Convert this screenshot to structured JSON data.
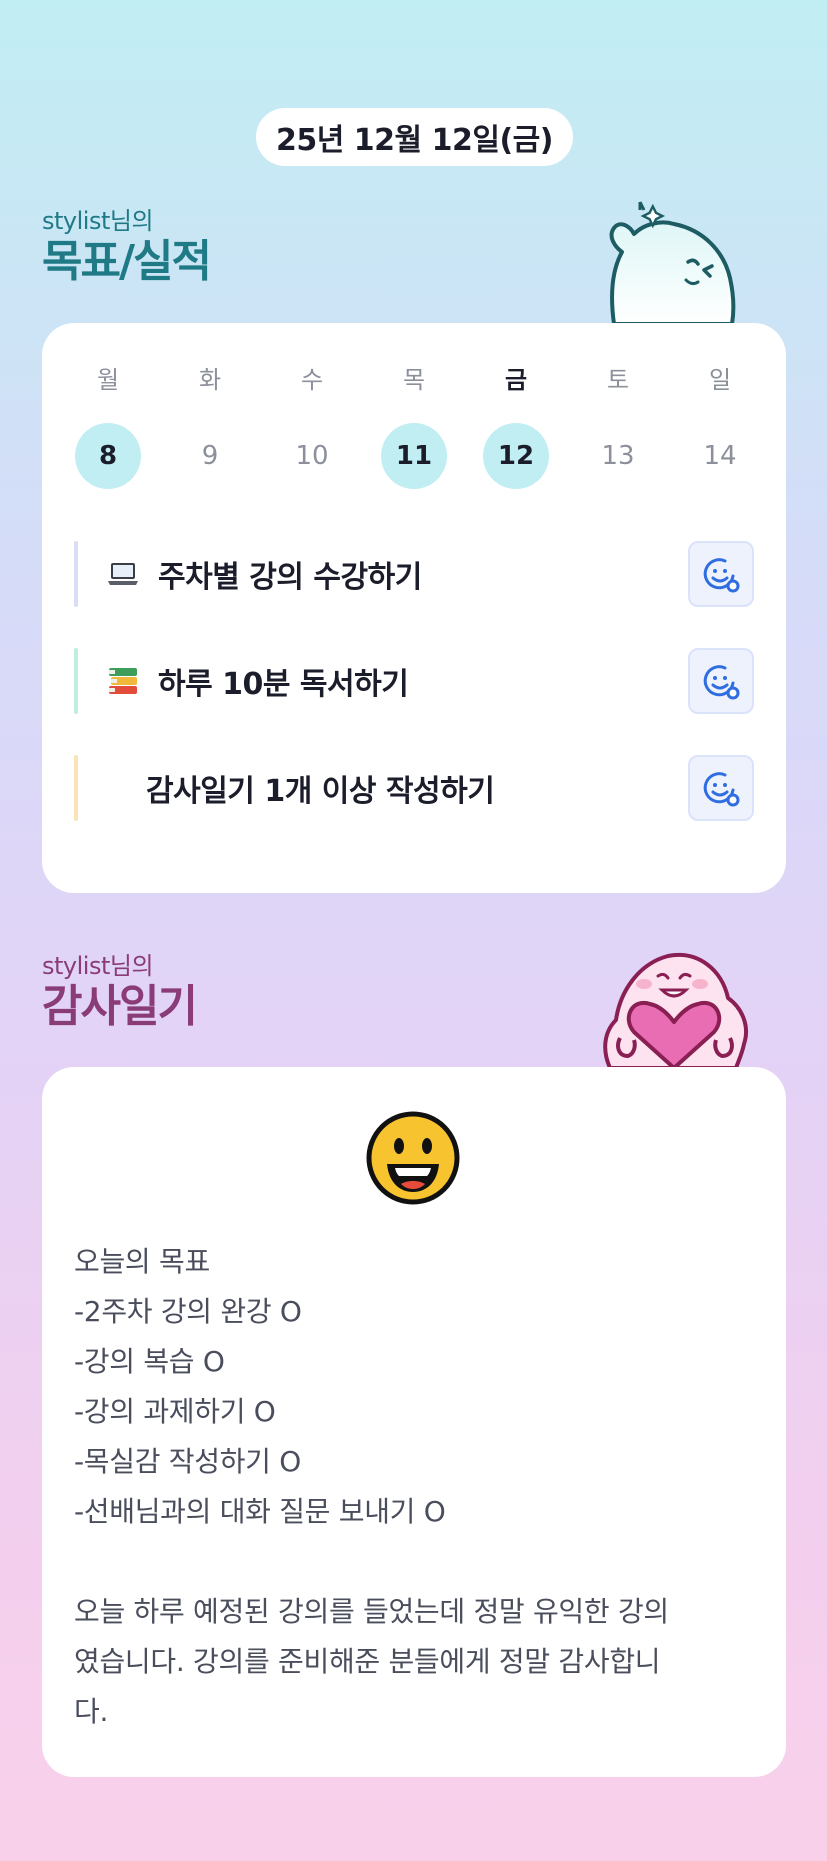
{
  "date": "25년 12월 12일(금)",
  "goals_section": {
    "subtitle": "stylist님의",
    "title": "목표/실적"
  },
  "week": [
    {
      "label": "월",
      "num": "8",
      "done": true,
      "today": false
    },
    {
      "label": "화",
      "num": "9",
      "done": false,
      "today": false
    },
    {
      "label": "수",
      "num": "10",
      "done": false,
      "today": false
    },
    {
      "label": "목",
      "num": "11",
      "done": true,
      "today": false
    },
    {
      "label": "금",
      "num": "12",
      "done": true,
      "today": true
    },
    {
      "label": "토",
      "num": "13",
      "done": false,
      "today": false
    },
    {
      "label": "일",
      "num": "14",
      "done": false,
      "today": false
    }
  ],
  "tasks": [
    {
      "icon": "laptop-icon",
      "text": "주차별 강의 수강하기",
      "bar_color": "#d9def7"
    },
    {
      "icon": "books-icon",
      "text": "하루 10분 독서하기",
      "bar_color": "#bfeedd"
    },
    {
      "icon": "",
      "text": "감사일기 1개 이상 작성하기",
      "bar_color": "#fbe3b8"
    }
  ],
  "gratitude_section": {
    "subtitle": "stylist님의",
    "title": "감사일기"
  },
  "diary": {
    "emoji": "grinning-face-icon",
    "text": "오늘의 목표\n-2주차 강의 완강 O\n-강의 복습 O\n-강의 과제하기 O\n-목실감 작성하기 O\n-선배님과의 대화 질문 보내기 O\n\n오늘 하루 예정된 강의를 들었는데 정말 유익한 강의\n였습니다. 강의를 준비해준 분들에게 정말 감사합니\n다."
  },
  "colors": {
    "goal_accent": "#1f7a86",
    "gratitude_accent": "#8a3c78",
    "done_circle": "#c1eef3",
    "task_button": "#eef2fd"
  }
}
